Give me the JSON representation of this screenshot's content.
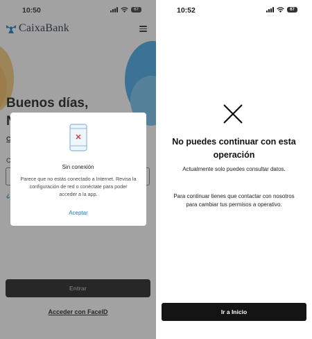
{
  "left_screen": {
    "status": {
      "time": "10:50",
      "battery": "67"
    },
    "brand": "CaixaBank",
    "greeting_line1": "Buenos días,",
    "greeting_line2": "N",
    "fragments": {
      "c_underlined": "C",
      "c_label": "C",
      "question": "¿"
    },
    "enter_button": "Entrar",
    "faceid_link": "Acceder con FaceID",
    "dialog": {
      "title": "Sin conexión",
      "message": "Parece que no estás conectado a Internet. Revisa la configuración de red o conéctate para poder acceder a la app.",
      "accept": "Aceptar",
      "icon": "phone-no-connection-icon"
    }
  },
  "right_screen": {
    "status": {
      "time": "10:52",
      "battery": "67"
    },
    "icon": "close-x-icon",
    "title": "No puedes continuar con esta operación",
    "subtitle": "Actualmente solo puedes consultar datos.",
    "note": "Para continuar tienes que contactar con nosotros para cambiar tus permisos a operativo.",
    "home_button": "Ir a Inicio"
  },
  "colors": {
    "brand_blue": "#0a7ac9",
    "button_dark": "#141414",
    "link_blue": "#1a79b8",
    "accent_red": "#d63a3a"
  }
}
